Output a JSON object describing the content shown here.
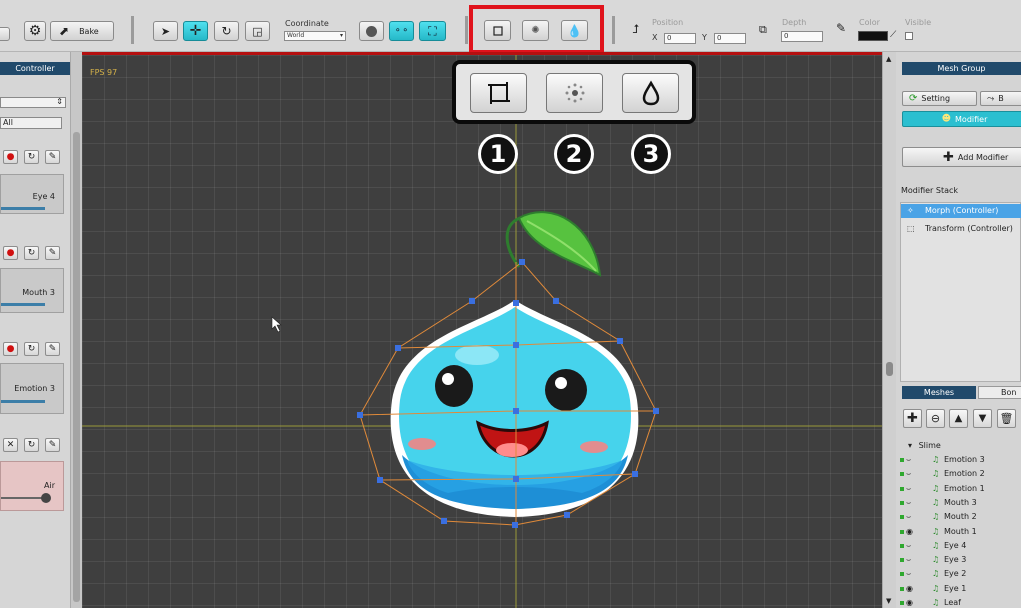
{
  "toolbar": {
    "bake_label": "Bake",
    "coordinate_label": "Coordinate",
    "coordinate_value": "World",
    "position_label": "Position",
    "x_label": "X",
    "x_value": "0",
    "y_label": "Y",
    "y_value": "0",
    "depth_label": "Depth",
    "depth_value": "0",
    "color_label": "Color",
    "visible_label": "Visible"
  },
  "left_panel": {
    "header": "Controller",
    "filter_value": "All",
    "controllers": [
      {
        "label": "Eye 4"
      },
      {
        "label": "Mouth 3"
      },
      {
        "label": "Emotion 3"
      },
      {
        "label": "Air"
      }
    ]
  },
  "viewport": {
    "fps": "FPS 97"
  },
  "callout": {
    "numbers": [
      "1",
      "2",
      "3"
    ]
  },
  "right_panel": {
    "header": "Mesh Group",
    "setting_tab": "Setting",
    "second_tab": "B",
    "modifier_tab": "Modifier",
    "add_modifier": "Add Modifier",
    "modifier_stack_label": "Modifier Stack",
    "modifiers": [
      {
        "label": "Morph (Controller)",
        "selected": true
      },
      {
        "label": "Transform (Controller)",
        "selected": false
      }
    ],
    "meshes_tab": "Meshes",
    "bones_tab": "Bon",
    "root_item": "Slime",
    "mesh_items": [
      "Emotion 3",
      "Emotion 2",
      "Emotion 1",
      "Mouth 3",
      "Mouth 2",
      "Mouth 1",
      "Eye 4",
      "Eye 3",
      "Eye 2",
      "Eye 1",
      "Leaf"
    ]
  },
  "colors": {
    "accent_cyan": "#2bbfd0",
    "selection_blue": "#4aa3e6",
    "header_navy": "#214a6b",
    "highlight_red": "#e0131c"
  }
}
